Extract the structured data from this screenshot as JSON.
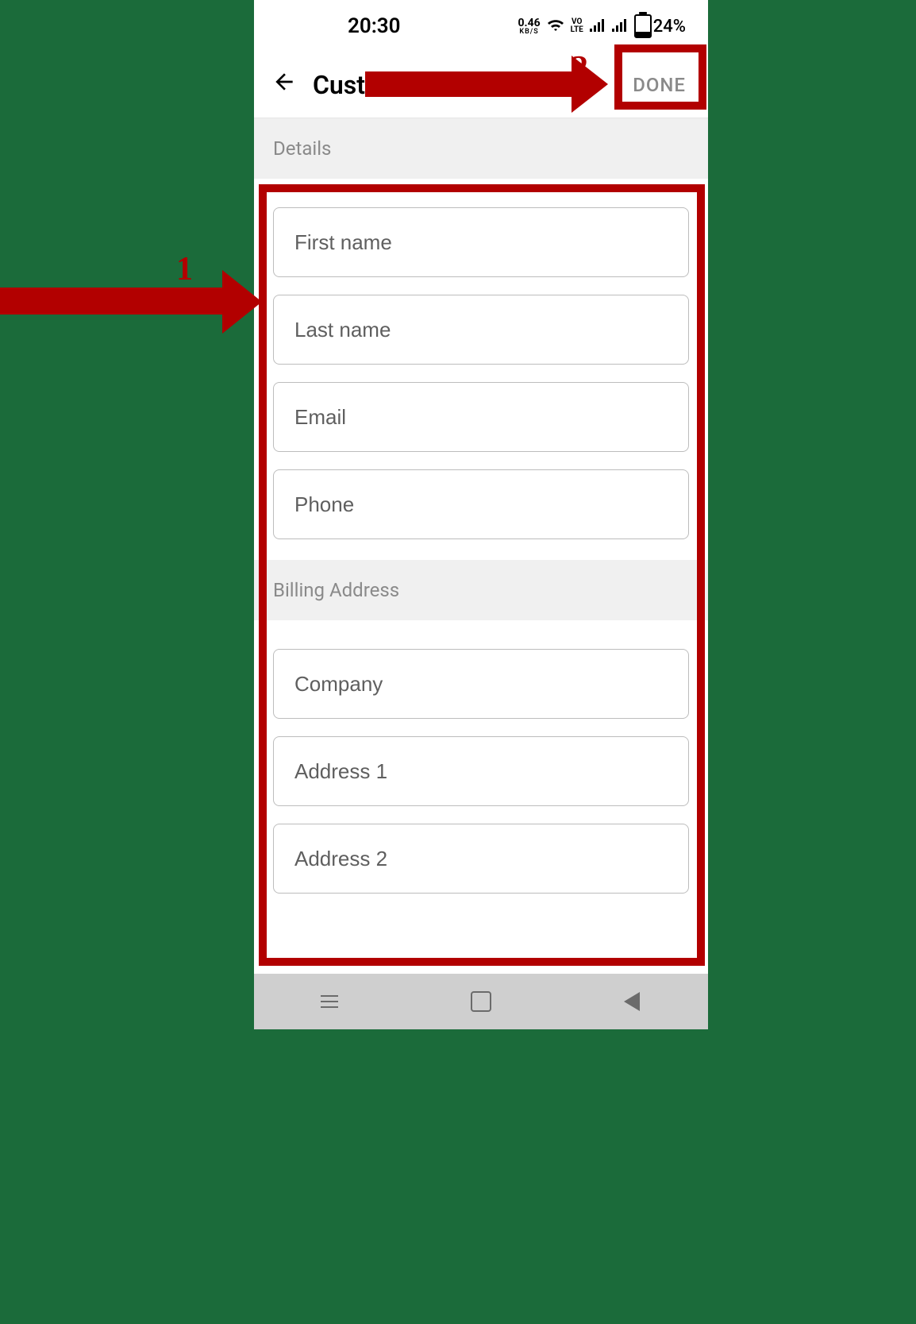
{
  "status": {
    "time": "20:30",
    "kbs_top": "0.46",
    "kbs_bot": "KB/S",
    "volte_top": "VO",
    "volte_bot": "LTE",
    "battery_pct": "24%"
  },
  "appbar": {
    "title": "Customer details",
    "done_label": "DONE"
  },
  "sections": {
    "details_header": "Details",
    "billing_header": "Billing Address"
  },
  "fields": {
    "first_name_placeholder": "First name",
    "last_name_placeholder": "Last name",
    "email_placeholder": "Email",
    "phone_placeholder": "Phone",
    "company_placeholder": "Company",
    "address1_placeholder": "Address 1",
    "address2_placeholder": "Address 2"
  },
  "annotations": {
    "num1": "1",
    "num2": "2"
  }
}
